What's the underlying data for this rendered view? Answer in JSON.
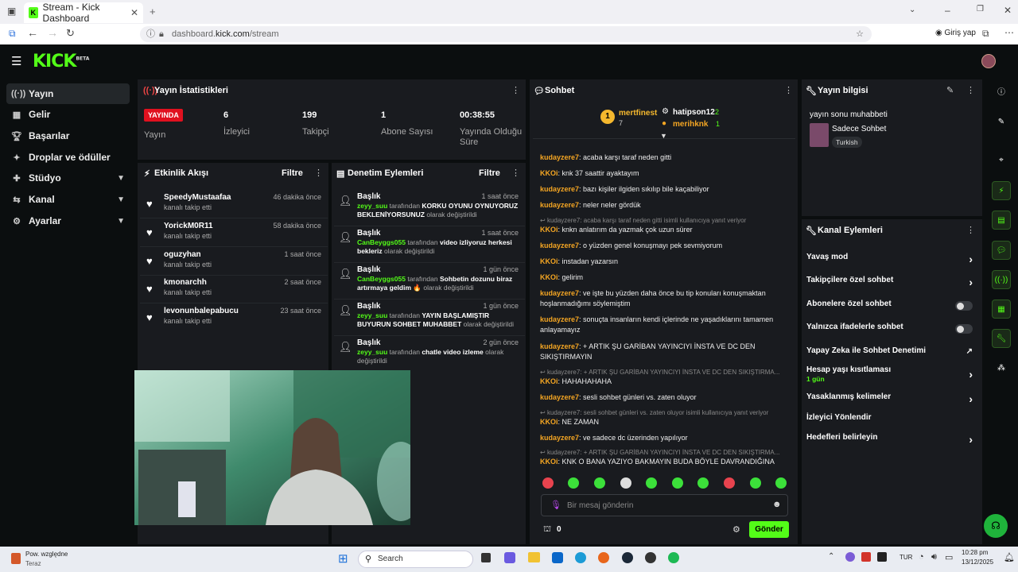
{
  "browser": {
    "tab_title": "Stream - Kick Dashboard",
    "url_prefix": "dashboard.",
    "url_host": "kick.com",
    "url_path": "/stream",
    "profile_label": "Giriş yap"
  },
  "header": {
    "logo": "KICK",
    "logo_tag": "BETA"
  },
  "sidebar": {
    "items": [
      {
        "label": "Yayın",
        "icon": "broadcast-icon"
      },
      {
        "label": "Gelir",
        "icon": "chart-icon"
      },
      {
        "label": "Başarılar",
        "icon": "trophy-icon"
      },
      {
        "label": "Droplar ve ödüller",
        "icon": "gift-icon"
      },
      {
        "label": "Stüdyo",
        "icon": "studio-icon"
      },
      {
        "label": "Kanal",
        "icon": "channel-icon"
      },
      {
        "label": "Ayarlar",
        "icon": "gear-icon"
      }
    ]
  },
  "stats": {
    "title": "Yayın İstatistikleri",
    "live_badge": "YAYINDA",
    "status_label": "Yayın",
    "viewers": "6",
    "viewers_label": "İzleyici",
    "followers": "199",
    "followers_label": "Takipçi",
    "subs": "1",
    "subs_label": "Abone Sayısı",
    "duration": "00:38:55",
    "duration_label": "Yayında Olduğu Süre"
  },
  "activity": {
    "title": "Etkinlik Akışı",
    "filter": "Filtre",
    "events": [
      {
        "name": "SpeedyMustaafaa",
        "sub": "kanalı takip etti",
        "time": "46 dakika önce"
      },
      {
        "name": "YorickM0R11",
        "sub": "kanalı takip etti",
        "time": "58 dakika önce"
      },
      {
        "name": "oguzyhan",
        "sub": "kanalı takip etti",
        "time": "1 saat önce"
      },
      {
        "name": "kmonarchh",
        "sub": "kanalı takip etti",
        "time": "2 saat önce"
      },
      {
        "name": "levonunbalepabucu",
        "sub": "kanalı takip etti",
        "time": "23 saat önce"
      }
    ]
  },
  "moderation": {
    "title": "Denetim Eylemleri",
    "filter": "Filtre",
    "items": [
      {
        "title": "Başlık",
        "time": "1 saat önce",
        "user": "zeyy_suu",
        "by": "tarafından",
        "value": "KORKU OYUNU OYNUYORUZ BEKLENİYORSUNUZ",
        "suffix": "olarak değiştirildi"
      },
      {
        "title": "Başlık",
        "time": "1 saat önce",
        "user": "CanBeyggs055",
        "by": "tarafından",
        "value": "video izliyoruz herkesi bekleriz",
        "suffix": "olarak değiştirildi"
      },
      {
        "title": "Başlık",
        "time": "1 gün önce",
        "user": "CanBeyggs055",
        "by": "tarafından",
        "value": "Sohbetin dozunu biraz artırmaya geldim 🔥",
        "suffix": "olarak değiştirildi"
      },
      {
        "title": "Başlık",
        "time": "1 gün önce",
        "user": "zeyy_suu",
        "by": "tarafından",
        "value": "YAYIN BAŞLAMIŞTIR BUYURUN SOHBET MUHABBET",
        "suffix": "olarak değiştirildi"
      },
      {
        "title": "Başlık",
        "time": "2 gün önce",
        "user": "zeyy_suu",
        "by": "tarafından",
        "value": "chatle video izleme",
        "suffix": "olarak değiştirildi"
      }
    ]
  },
  "chat": {
    "title": "Sohbet",
    "top": [
      {
        "name": "mertfinest",
        "count": "7",
        "rank": "1"
      },
      {
        "name": "hatipson12",
        "count": "2"
      },
      {
        "name": "merihknk",
        "count": "1"
      }
    ],
    "messages": [
      {
        "type": "msg",
        "user": "kudayzere7",
        "text": "acaba karşı taraf neden gitti"
      },
      {
        "type": "msg",
        "user": "KKOi",
        "text": "knk 37 saattir ayaktayım"
      },
      {
        "type": "msg",
        "user": "kudayzere7",
        "text": "bazı kişiler ilgiden sıkılıp bile kaçabiliyor"
      },
      {
        "type": "msg",
        "user": "kudayzere7",
        "text": "neler neler gördük"
      },
      {
        "type": "reply",
        "text": "kudayzere7: acaba karşı taraf neden gitti isimli kullanıcıya yanıt veriyor"
      },
      {
        "type": "msg",
        "user": "KKOi",
        "text": "knkn anlatırım da yazmak çok uzun sürer"
      },
      {
        "type": "msg",
        "user": "kudayzere7",
        "text": "o yüzden genel konuşmayı pek sevmiyorum"
      },
      {
        "type": "msg",
        "user": "KKOi",
        "text": "instadan yazarsın"
      },
      {
        "type": "msg",
        "user": "KKOi",
        "text": "gelirim"
      },
      {
        "type": "msg",
        "user": "kudayzere7",
        "text": "ve işte bu yüzden daha önce bu tip konuları konuşmaktan hoşlanmadığımı söylemiştim"
      },
      {
        "type": "msg",
        "user": "kudayzere7",
        "text": "sonuçta insanların kendi içlerinde ne yaşadıklarını tamamen anlayamayız"
      },
      {
        "type": "msg",
        "user": "kudayzere7",
        "text": "+ ARTIK ŞU GARİBAN YAYINCIYI İNSTA VE DC DEN SIKIŞTIRMAYIN"
      },
      {
        "type": "reply",
        "text": "kudayzere7: + ARTIK ŞU GARİBAN YAYINCIYI İNSTA VE DC DEN SIKIŞTIRMA..."
      },
      {
        "type": "msg",
        "user": "KKOi",
        "text": "HAHAHAHAHA"
      },
      {
        "type": "msg",
        "user": "kudayzere7",
        "text": "sesli sohbet günleri vs. zaten oluyor"
      },
      {
        "type": "reply",
        "text": "kudayzere7: sesli sohbet günleri vs. zaten oluyor isimli kullanıcıya yanıt veriyor"
      },
      {
        "type": "msg",
        "user": "KKOi",
        "text": "NE ZAMAN"
      },
      {
        "type": "msg",
        "user": "kudayzere7",
        "text": "ve sadece dc üzerinden yapılıyor"
      },
      {
        "type": "reply",
        "text": "kudayzere7: + ARTIK ŞU GARİBAN YAYINCIYI İNSTA VE DC DEN SIKIŞTIRMA..."
      },
      {
        "type": "msg",
        "user": "KKOi",
        "text": "KNK O BANA YAZIYO BAKMAYIN BUDA BÖYLE DAVRANDIĞINA"
      }
    ],
    "placeholder": "Bir mesaj gönderin",
    "points": "0",
    "send_label": "Gönder"
  },
  "stream_info": {
    "title": "Yayın bilgisi",
    "stream_title": "yayın sonu muhabbeti",
    "category": "Sadece Sohbet",
    "language": "Turkish"
  },
  "channel_actions": {
    "title": "Kanal Eylemleri",
    "items": [
      {
        "label": "Yavaş mod",
        "control": "chevron"
      },
      {
        "label": "Takipçilere özel sohbet",
        "control": "chevron"
      },
      {
        "label": "Abonelere özel sohbet",
        "control": "toggle"
      },
      {
        "label": "Yalnızca ifadelerle sohbet",
        "control": "toggle"
      },
      {
        "label": "Yapay Zeka ile Sohbet Denetimi",
        "control": "link"
      },
      {
        "label": "Hesap yaşı kısıtlaması",
        "sub": "1 gün",
        "control": "chevron"
      },
      {
        "label": "Yasaklanmış kelimeler",
        "control": "chevron"
      },
      {
        "label": "İzleyici Yönlendir",
        "control": "none"
      },
      {
        "label": "Hedefleri belirleyin",
        "control": "chevron"
      }
    ]
  },
  "taskbar": {
    "weather_title": "Pow. względne",
    "weather_sub": "Teraz",
    "search": "Search",
    "lang": "TUR",
    "time": "10:28 pm",
    "date": "13/12/2025"
  }
}
